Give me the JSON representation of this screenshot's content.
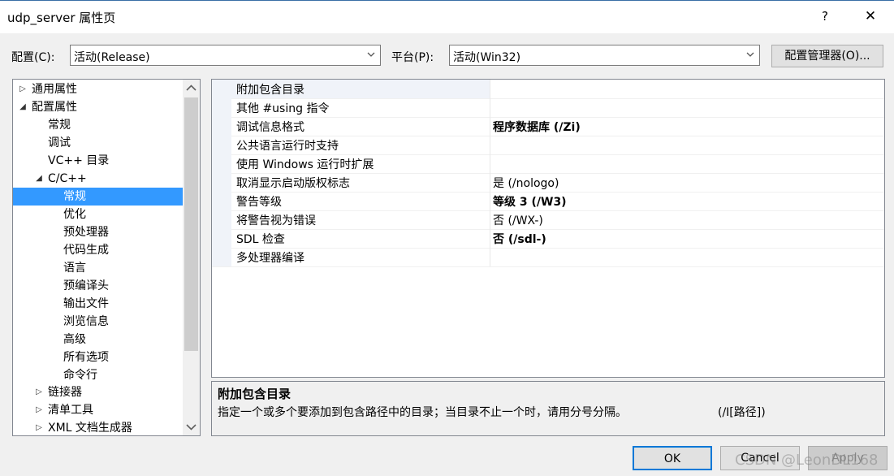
{
  "window": {
    "title": "udp_server 属性页",
    "help": "?",
    "close": "✕"
  },
  "toolbar": {
    "config_label": "配置(C):",
    "config_value": "活动(Release)",
    "platform_label": "平台(P):",
    "platform_value": "活动(Win32)",
    "config_manager_label": "配置管理器(O)..."
  },
  "tree": {
    "items": [
      {
        "label": "通用属性",
        "expander": "▷"
      },
      {
        "label": "配置属性",
        "expander": "◢"
      },
      {
        "label": "常规",
        "expander": ""
      },
      {
        "label": "调试",
        "expander": ""
      },
      {
        "label": "VC++ 目录",
        "expander": ""
      },
      {
        "label": "C/C++",
        "expander": "◢"
      },
      {
        "label": "常规",
        "expander": ""
      },
      {
        "label": "优化",
        "expander": ""
      },
      {
        "label": "预处理器",
        "expander": ""
      },
      {
        "label": "代码生成",
        "expander": ""
      },
      {
        "label": "语言",
        "expander": ""
      },
      {
        "label": "预编译头",
        "expander": ""
      },
      {
        "label": "输出文件",
        "expander": ""
      },
      {
        "label": "浏览信息",
        "expander": ""
      },
      {
        "label": "高级",
        "expander": ""
      },
      {
        "label": "所有选项",
        "expander": ""
      },
      {
        "label": "命令行",
        "expander": ""
      },
      {
        "label": "链接器",
        "expander": "▷"
      },
      {
        "label": "清单工具",
        "expander": "▷"
      },
      {
        "label": "XML 文档生成器",
        "expander": "▷"
      }
    ]
  },
  "properties": {
    "rows": [
      {
        "name": "附加包含目录",
        "value": ""
      },
      {
        "name": "其他 #using 指令",
        "value": ""
      },
      {
        "name": "调试信息格式",
        "value": "程序数据库 (/Zi)"
      },
      {
        "name": "公共语言运行时支持",
        "value": ""
      },
      {
        "name": "使用 Windows 运行时扩展",
        "value": ""
      },
      {
        "name": "取消显示启动版权标志",
        "value": "是 (/nologo)"
      },
      {
        "name": "警告等级",
        "value": "等级 3 (/W3)"
      },
      {
        "name": "将警告视为错误",
        "value": "否 (/WX-)"
      },
      {
        "name": "SDL 检查",
        "value": "否 (/sdl-)"
      },
      {
        "name": "多处理器编译",
        "value": ""
      }
    ]
  },
  "description": {
    "title": "附加包含目录",
    "text": "指定一个或多个要添加到包含路径中的目录；当目录不止一个时，请用分号分隔。",
    "flag": "(/I[路径])"
  },
  "footer": {
    "ok": "OK",
    "cancel": "Cancel",
    "apply": "Apply"
  },
  "watermark": "CSDN @LeonDL168"
}
